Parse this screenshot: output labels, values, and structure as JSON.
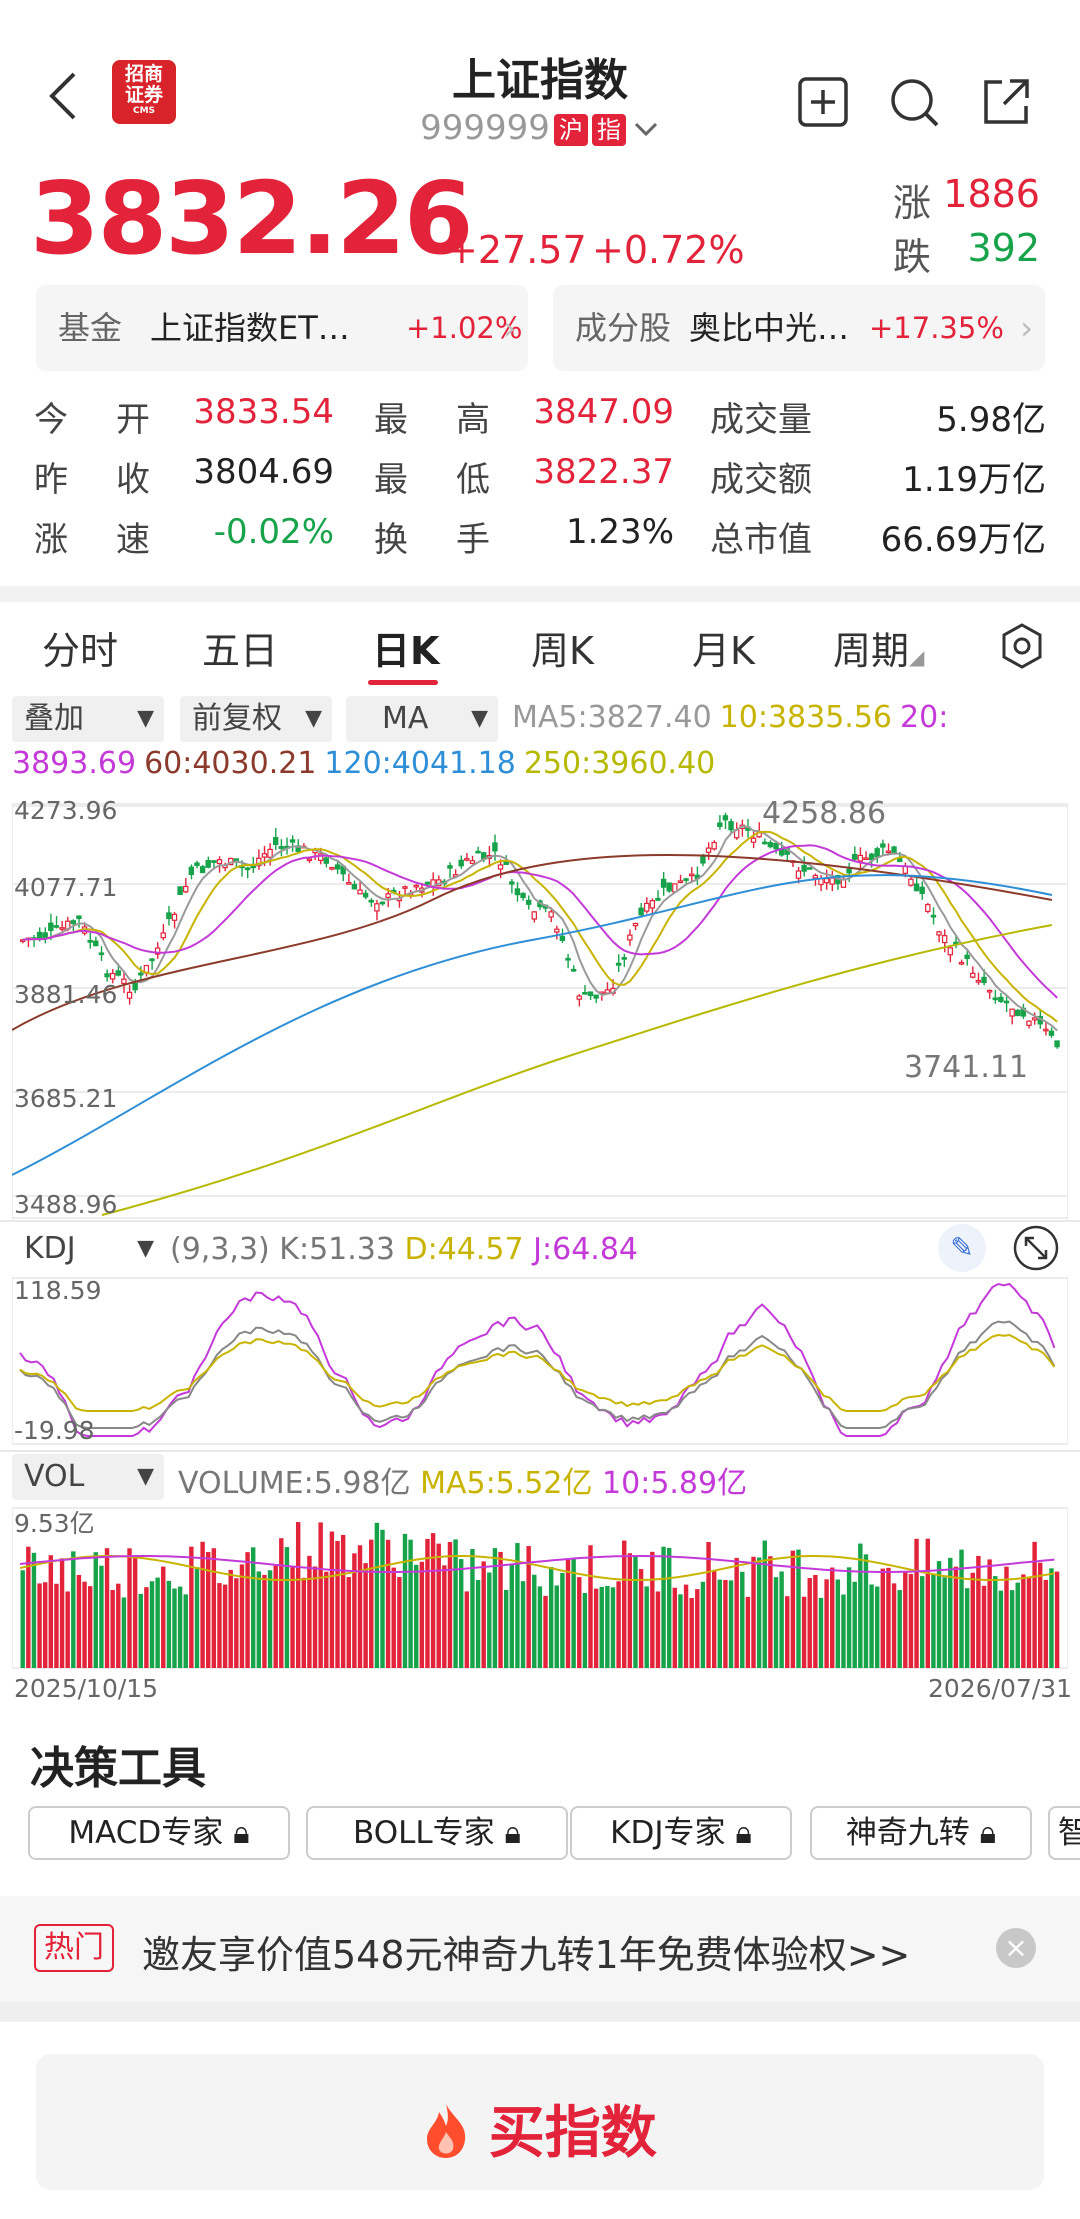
{
  "header": {
    "title": "上证指数",
    "code": "999999",
    "market_tag": "沪",
    "index_tag": "指",
    "logo_text": "招商证券",
    "logo_sub": "CMS"
  },
  "quote": {
    "price": "3832.26",
    "change": "+27.57",
    "change_pct": "+0.72%",
    "rise_label": "涨",
    "rise_count": "1886",
    "fall_label": "跌",
    "fall_count": "392"
  },
  "pills": [
    {
      "label": "基金",
      "name": "上证指数ET…",
      "value": "+1.02%"
    },
    {
      "label": "成分股",
      "name": "奥比中光…",
      "value": "+17.35%"
    }
  ],
  "stats": [
    {
      "k1": "今",
      "k2": "开",
      "v": "3833.54",
      "c": "red",
      "k3": "最",
      "k4": "高",
      "v2": "3847.09",
      "c2": "red",
      "k5": "成交量",
      "v3": "5.98亿"
    },
    {
      "k1": "昨",
      "k2": "收",
      "v": "3804.69",
      "c": "dark",
      "k3": "最",
      "k4": "低",
      "v2": "3822.37",
      "c2": "red",
      "k5": "成交额",
      "v3": "1.19万亿"
    },
    {
      "k1": "涨",
      "k2": "速",
      "v": "-0.02%",
      "c": "green",
      "k3": "换",
      "k4": "手",
      "v2": "1.23%",
      "c2": "dark",
      "k5": "总市值",
      "v3": "66.69万亿"
    }
  ],
  "tabs": [
    "分时",
    "五日",
    "日K",
    "周K",
    "月K",
    "周期"
  ],
  "selectors": {
    "overlay": "叠加",
    "adjust": "前复权",
    "indicator": "MA"
  },
  "ma_line1": [
    {
      "t": "MA5:3827.40",
      "c": "#999999"
    },
    {
      "t": "10:3835.56",
      "c": "#c8b400"
    },
    {
      "t": "20:",
      "c": "#c43ad8"
    }
  ],
  "ma_line2": [
    {
      "t": "3893.69",
      "c": "#c43ad8"
    },
    {
      "t": "60:4030.21",
      "c": "#8b3a2b"
    },
    {
      "t": "120:4041.18",
      "c": "#2e8fd6"
    },
    {
      "t": "250:3960.40",
      "c": "#b7b800"
    }
  ],
  "kline_axis": [
    "4273.96",
    "4077.71",
    "3881.46",
    "3685.21",
    "3488.96"
  ],
  "kline_marks": {
    "high": "4258.86",
    "low": "3741.11"
  },
  "kdj": {
    "selector": "KDJ",
    "params": "(9,3,3)",
    "k": "K:51.33",
    "d": "D:44.57",
    "j": "J:64.84",
    "axis_top": "118.59",
    "axis_bottom": "-19.98"
  },
  "vol": {
    "selector": "VOL",
    "volume": "VOLUME:5.98亿",
    "ma5": "MA5:5.52亿",
    "ma10": "10:5.89亿",
    "axis_top": "9.53亿",
    "date_start": "2025/10/15",
    "date_end": "2026/07/31"
  },
  "tools": {
    "title": "决策工具",
    "chips": [
      "MACD专家",
      "BOLL专家",
      "KDJ专家",
      "神奇九转",
      "智"
    ]
  },
  "promo": {
    "tag": "热门",
    "text": "邀友享价值548元神奇九转1年免费体验权>>"
  },
  "buy": {
    "label": "买指数"
  },
  "colors": {
    "up": "#e2233a",
    "down": "#17a34a"
  }
}
